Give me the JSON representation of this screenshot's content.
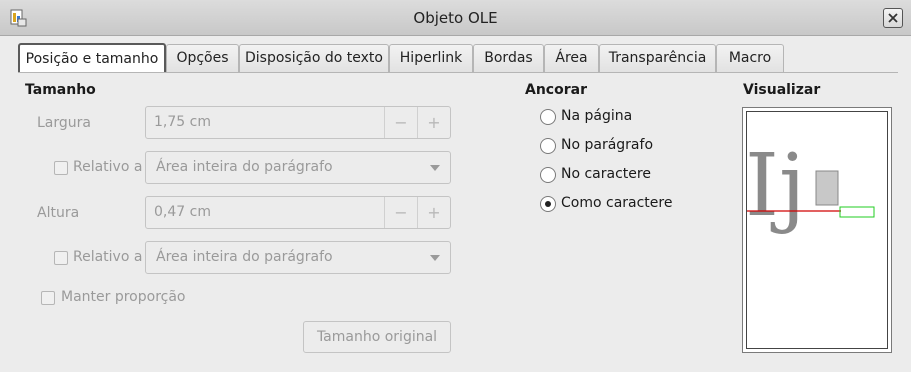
{
  "window": {
    "title": "Objeto OLE"
  },
  "tabs": [
    {
      "label": "Posição e tamanho",
      "active": true
    },
    {
      "label": "Opções"
    },
    {
      "label": "Disposição do texto"
    },
    {
      "label": "Hiperlink"
    },
    {
      "label": "Bordas"
    },
    {
      "label": "Área"
    },
    {
      "label": "Transparência"
    },
    {
      "label": "Macro"
    }
  ],
  "size": {
    "heading": "Tamanho",
    "width_label": "Largura",
    "width_value": "1,75 cm",
    "relative_label": "Relativo a",
    "relative_value": "Área inteira do parágrafo",
    "height_label": "Altura",
    "height_value": "0,47 cm",
    "relative2_label": "Relativo a",
    "relative2_value": "Área inteira do parágrafo",
    "keep_ratio_label": "Manter proporção",
    "original_size_label": "Tamanho original",
    "minus": "−",
    "plus": "+"
  },
  "anchor": {
    "heading": "Ancorar",
    "options": [
      {
        "label": "Na página",
        "checked": false
      },
      {
        "label": "No parágrafo",
        "checked": false
      },
      {
        "label": "No caractere",
        "checked": false
      },
      {
        "label": "Como caractere",
        "checked": true
      }
    ]
  },
  "preview": {
    "heading": "Visualizar",
    "sample_text": "Ij",
    "baseline_color": "#d00000",
    "object_frame_color": "#22cc22",
    "object_fill_color": "#c8c8c8"
  }
}
